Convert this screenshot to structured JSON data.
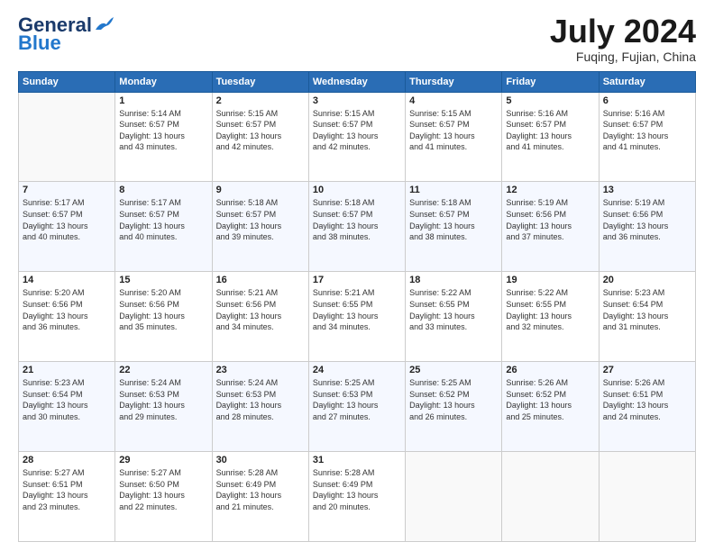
{
  "header": {
    "logo_line1": "General",
    "logo_line2": "Blue",
    "month": "July 2024",
    "location": "Fuqing, Fujian, China"
  },
  "weekdays": [
    "Sunday",
    "Monday",
    "Tuesday",
    "Wednesday",
    "Thursday",
    "Friday",
    "Saturday"
  ],
  "weeks": [
    [
      {
        "day": null,
        "info": null
      },
      {
        "day": "1",
        "info": "Sunrise: 5:14 AM\nSunset: 6:57 PM\nDaylight: 13 hours\nand 43 minutes."
      },
      {
        "day": "2",
        "info": "Sunrise: 5:15 AM\nSunset: 6:57 PM\nDaylight: 13 hours\nand 42 minutes."
      },
      {
        "day": "3",
        "info": "Sunrise: 5:15 AM\nSunset: 6:57 PM\nDaylight: 13 hours\nand 42 minutes."
      },
      {
        "day": "4",
        "info": "Sunrise: 5:15 AM\nSunset: 6:57 PM\nDaylight: 13 hours\nand 41 minutes."
      },
      {
        "day": "5",
        "info": "Sunrise: 5:16 AM\nSunset: 6:57 PM\nDaylight: 13 hours\nand 41 minutes."
      },
      {
        "day": "6",
        "info": "Sunrise: 5:16 AM\nSunset: 6:57 PM\nDaylight: 13 hours\nand 41 minutes."
      }
    ],
    [
      {
        "day": "7",
        "info": "Sunrise: 5:17 AM\nSunset: 6:57 PM\nDaylight: 13 hours\nand 40 minutes."
      },
      {
        "day": "8",
        "info": "Sunrise: 5:17 AM\nSunset: 6:57 PM\nDaylight: 13 hours\nand 40 minutes."
      },
      {
        "day": "9",
        "info": "Sunrise: 5:18 AM\nSunset: 6:57 PM\nDaylight: 13 hours\nand 39 minutes."
      },
      {
        "day": "10",
        "info": "Sunrise: 5:18 AM\nSunset: 6:57 PM\nDaylight: 13 hours\nand 38 minutes."
      },
      {
        "day": "11",
        "info": "Sunrise: 5:18 AM\nSunset: 6:57 PM\nDaylight: 13 hours\nand 38 minutes."
      },
      {
        "day": "12",
        "info": "Sunrise: 5:19 AM\nSunset: 6:56 PM\nDaylight: 13 hours\nand 37 minutes."
      },
      {
        "day": "13",
        "info": "Sunrise: 5:19 AM\nSunset: 6:56 PM\nDaylight: 13 hours\nand 36 minutes."
      }
    ],
    [
      {
        "day": "14",
        "info": "Sunrise: 5:20 AM\nSunset: 6:56 PM\nDaylight: 13 hours\nand 36 minutes."
      },
      {
        "day": "15",
        "info": "Sunrise: 5:20 AM\nSunset: 6:56 PM\nDaylight: 13 hours\nand 35 minutes."
      },
      {
        "day": "16",
        "info": "Sunrise: 5:21 AM\nSunset: 6:56 PM\nDaylight: 13 hours\nand 34 minutes."
      },
      {
        "day": "17",
        "info": "Sunrise: 5:21 AM\nSunset: 6:55 PM\nDaylight: 13 hours\nand 34 minutes."
      },
      {
        "day": "18",
        "info": "Sunrise: 5:22 AM\nSunset: 6:55 PM\nDaylight: 13 hours\nand 33 minutes."
      },
      {
        "day": "19",
        "info": "Sunrise: 5:22 AM\nSunset: 6:55 PM\nDaylight: 13 hours\nand 32 minutes."
      },
      {
        "day": "20",
        "info": "Sunrise: 5:23 AM\nSunset: 6:54 PM\nDaylight: 13 hours\nand 31 minutes."
      }
    ],
    [
      {
        "day": "21",
        "info": "Sunrise: 5:23 AM\nSunset: 6:54 PM\nDaylight: 13 hours\nand 30 minutes."
      },
      {
        "day": "22",
        "info": "Sunrise: 5:24 AM\nSunset: 6:53 PM\nDaylight: 13 hours\nand 29 minutes."
      },
      {
        "day": "23",
        "info": "Sunrise: 5:24 AM\nSunset: 6:53 PM\nDaylight: 13 hours\nand 28 minutes."
      },
      {
        "day": "24",
        "info": "Sunrise: 5:25 AM\nSunset: 6:53 PM\nDaylight: 13 hours\nand 27 minutes."
      },
      {
        "day": "25",
        "info": "Sunrise: 5:25 AM\nSunset: 6:52 PM\nDaylight: 13 hours\nand 26 minutes."
      },
      {
        "day": "26",
        "info": "Sunrise: 5:26 AM\nSunset: 6:52 PM\nDaylight: 13 hours\nand 25 minutes."
      },
      {
        "day": "27",
        "info": "Sunrise: 5:26 AM\nSunset: 6:51 PM\nDaylight: 13 hours\nand 24 minutes."
      }
    ],
    [
      {
        "day": "28",
        "info": "Sunrise: 5:27 AM\nSunset: 6:51 PM\nDaylight: 13 hours\nand 23 minutes."
      },
      {
        "day": "29",
        "info": "Sunrise: 5:27 AM\nSunset: 6:50 PM\nDaylight: 13 hours\nand 22 minutes."
      },
      {
        "day": "30",
        "info": "Sunrise: 5:28 AM\nSunset: 6:49 PM\nDaylight: 13 hours\nand 21 minutes."
      },
      {
        "day": "31",
        "info": "Sunrise: 5:28 AM\nSunset: 6:49 PM\nDaylight: 13 hours\nand 20 minutes."
      },
      {
        "day": null,
        "info": null
      },
      {
        "day": null,
        "info": null
      },
      {
        "day": null,
        "info": null
      }
    ]
  ]
}
